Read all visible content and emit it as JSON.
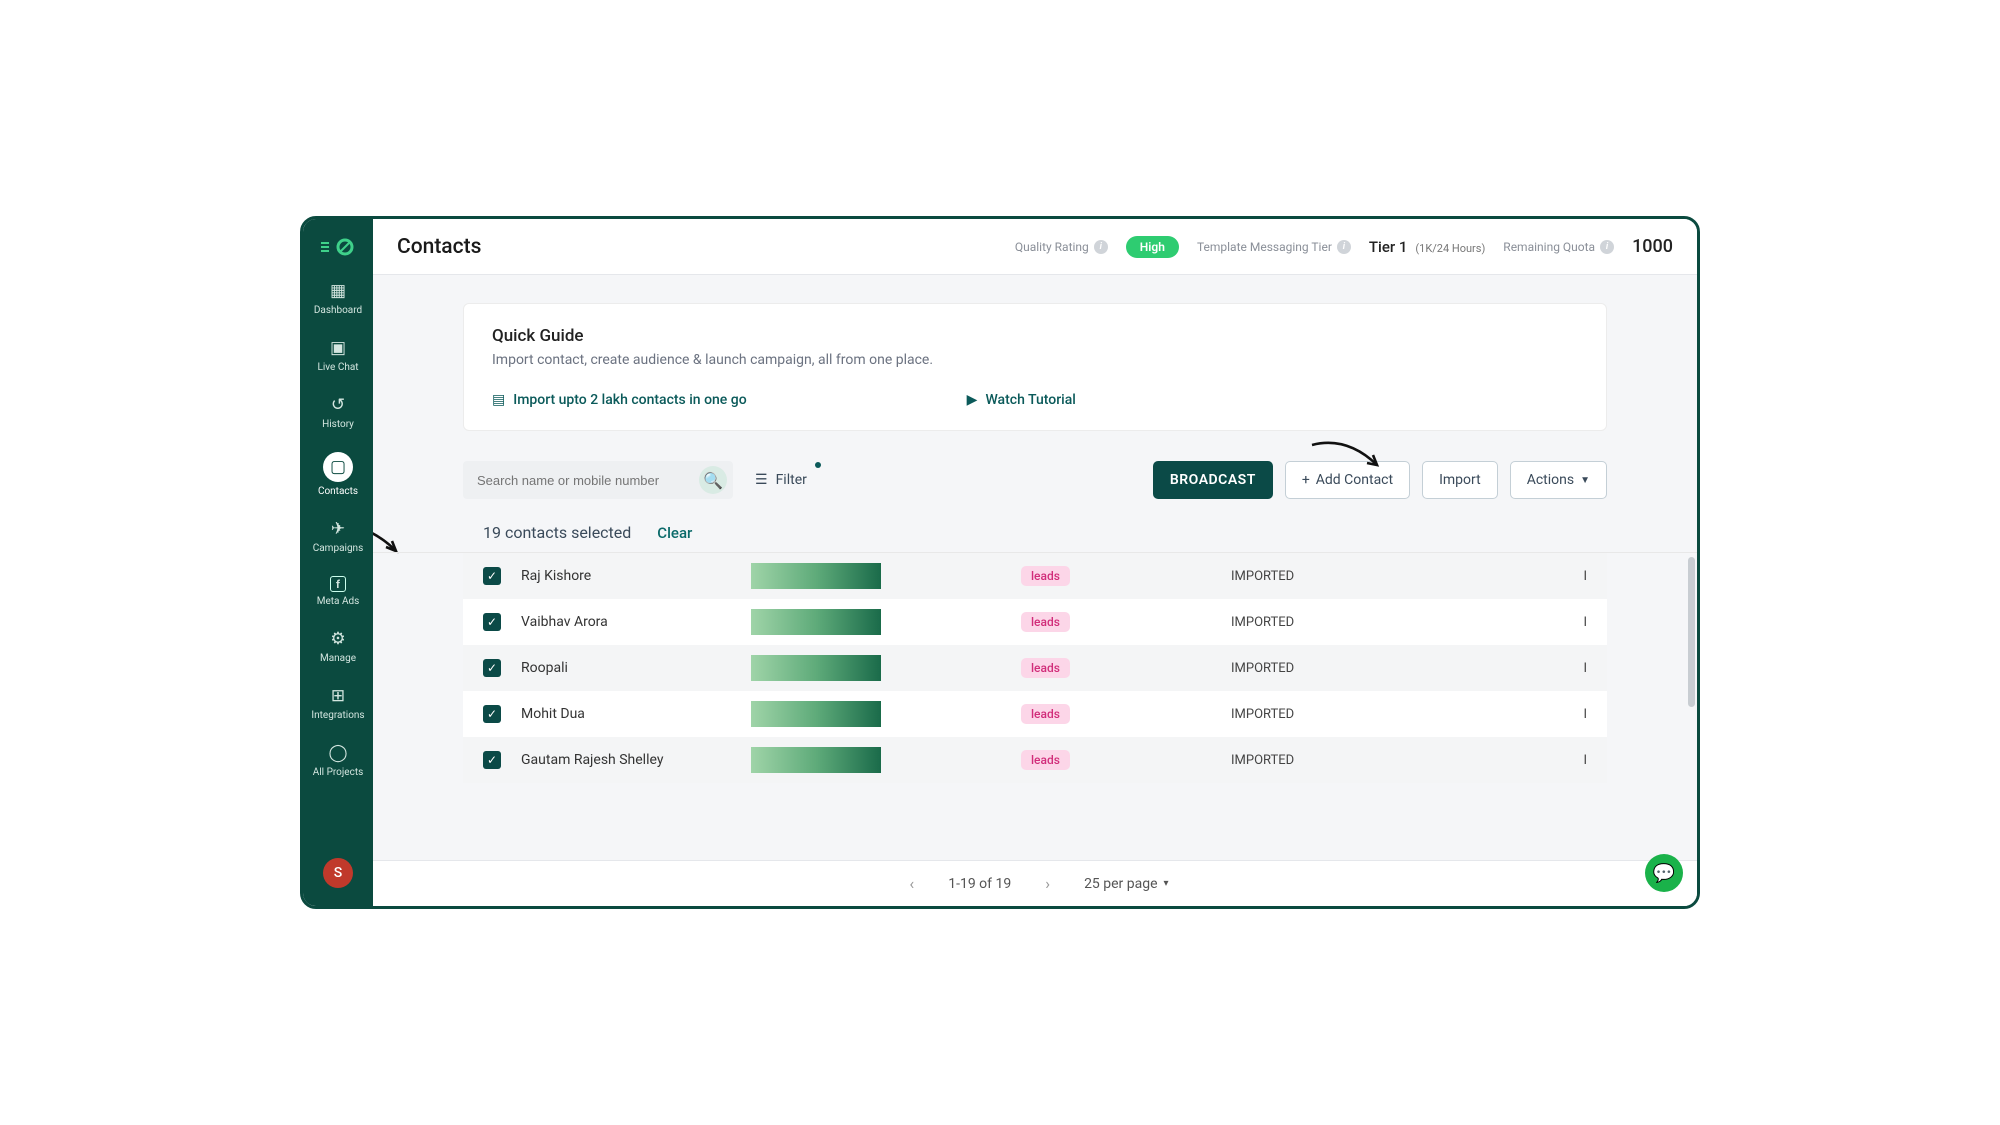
{
  "sidebar": {
    "logo_text": "⋮⋮",
    "items": [
      {
        "icon": "▦",
        "label": "Dashboard"
      },
      {
        "icon": "▣",
        "label": "Live Chat"
      },
      {
        "icon": "↺",
        "label": "History"
      },
      {
        "icon": "▢",
        "label": "Contacts"
      },
      {
        "icon": "✈",
        "label": "Campaigns"
      },
      {
        "icon": "f",
        "label": "Meta Ads"
      },
      {
        "icon": "⚙",
        "label": "Manage"
      },
      {
        "icon": "⊞",
        "label": "Integrations"
      },
      {
        "icon": "◯",
        "label": "All Projects"
      }
    ],
    "avatar_letter": "S"
  },
  "topbar": {
    "title": "Contacts",
    "quality_label": "Quality Rating",
    "quality_value": "High",
    "tier_label": "Template Messaging Tier",
    "tier_value": "Tier 1",
    "tier_sub": "(1K/24 Hours)",
    "quota_label": "Remaining Quota",
    "quota_value": "1000"
  },
  "guide": {
    "title": "Quick Guide",
    "subtitle": "Import contact, create audience & launch campaign, all from one place.",
    "link1": "Import upto 2 lakh contacts in one go",
    "link2": "Watch Tutorial"
  },
  "toolbar": {
    "search_placeholder": "Search name or mobile number",
    "filter_label": "Filter",
    "broadcast": "BROADCAST",
    "add_contact": "Add Contact",
    "import": "Import",
    "actions": "Actions"
  },
  "selection": {
    "count_text": "19 contacts selected",
    "clear": "Clear"
  },
  "rows": [
    {
      "name": "Raj Kishore",
      "tag": "leads",
      "status": "IMPORTED",
      "extra": "I"
    },
    {
      "name": "Vaibhav Arora",
      "tag": "leads",
      "status": "IMPORTED",
      "extra": "I"
    },
    {
      "name": "Roopali",
      "tag": "leads",
      "status": "IMPORTED",
      "extra": "I"
    },
    {
      "name": "Mohit Dua",
      "tag": "leads",
      "status": "IMPORTED",
      "extra": "I"
    },
    {
      "name": "Gautam Rajesh Shelley",
      "tag": "leads",
      "status": "IMPORTED",
      "extra": "I"
    }
  ],
  "pager": {
    "range": "1-19 of 19",
    "per_page": "25 per page"
  }
}
